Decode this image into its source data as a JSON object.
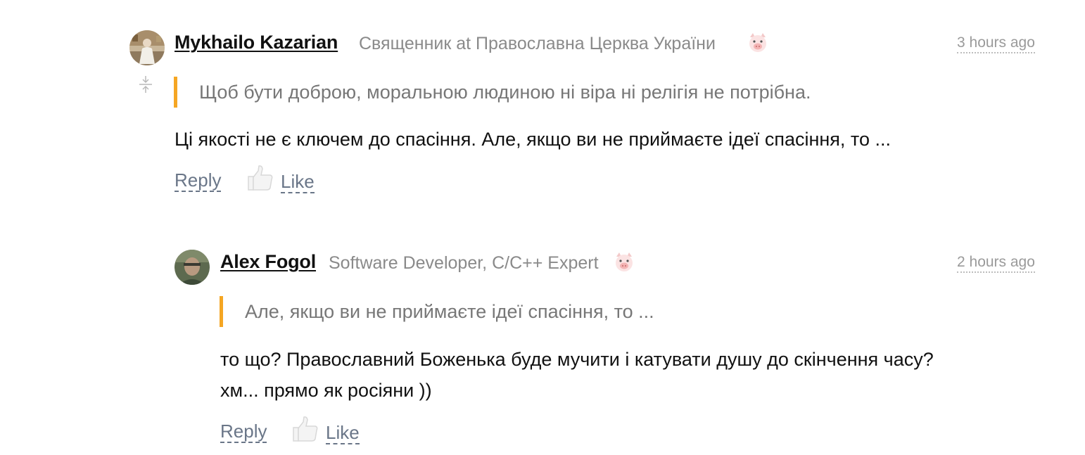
{
  "comments": [
    {
      "author": "Mykhailo Kazarian",
      "role": "Священник at Православна Церква України",
      "time": "3 hours ago",
      "quote": "Щоб бути доброю, моральною людиною ні віра ні релігія не потрібна.",
      "body_lines": [
        "Ці якості не є ключем до спасіння. Але, якщо ви не приймаєте ідеї спасіння, то ..."
      ],
      "reply_label": "Reply",
      "like_label": "Like",
      "avatar_icon": "avatar-photo",
      "badge_icon": "pig-face-icon"
    },
    {
      "author": "Alex Fogol",
      "role": "Software Developer, C/C++ Expert",
      "time": "2 hours ago",
      "quote": "Але, якщо ви не приймаєте ідеї спасіння, то ...",
      "body_lines": [
        "то що? Православний Боженька буде мучити і катувати душу до скінчення часу?",
        "хм... прямо як росіяни ))"
      ],
      "reply_label": "Reply",
      "like_label": "Like",
      "avatar_icon": "avatar-photo",
      "badge_icon": "pig-face-icon"
    }
  ],
  "colors": {
    "quote_bar": "#f5a623",
    "link": "#6a7688",
    "muted": "#8a8a8a"
  }
}
